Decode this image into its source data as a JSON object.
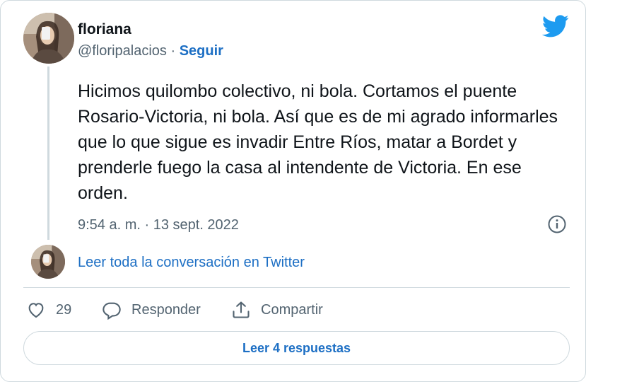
{
  "author": {
    "name": "floriana",
    "handle": "@floripalacios",
    "separator": "·",
    "follow_label": "Seguir"
  },
  "tweet": {
    "text": "Hicimos quilombo colectivo, ni bola. Cortamos el puente Rosario-Victoria, ni bola. Así que es de mi agrado informarles que lo que sigue es invadir Entre Ríos, matar a Bordet y prenderle fuego la casa al intendente de Victoria. En ese orden.",
    "timestamp": "9:54 a. m. · 13 sept. 2022"
  },
  "conversation_link": "Leer toda la conversación en Twitter",
  "actions": {
    "like_count": "29",
    "reply_label": "Responder",
    "share_label": "Compartir"
  },
  "read_replies_label": "Leer 4 respuestas",
  "colors": {
    "link": "#1d6fc4",
    "twitter_blue": "#1d9bf0",
    "muted": "#536471",
    "border": "#cfd9de"
  },
  "icons": [
    "twitter-bird-icon",
    "info-icon",
    "heart-icon",
    "reply-bubble-icon",
    "share-icon"
  ]
}
